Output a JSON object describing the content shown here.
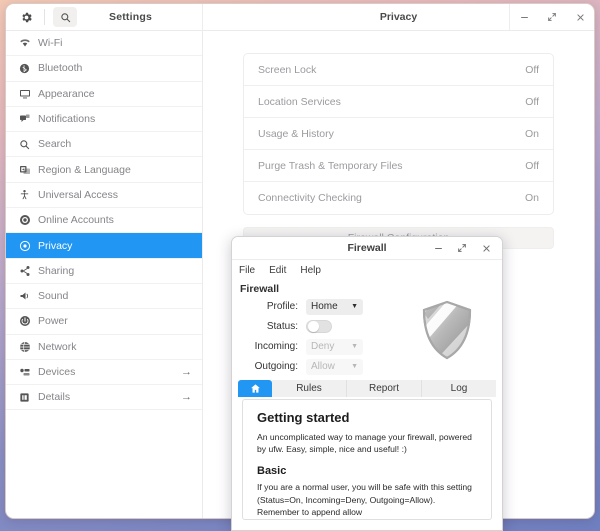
{
  "desktop": {
    "bg_top": "#f3c9b4",
    "bg_bottom": "#6f7fc0"
  },
  "settings_window": {
    "app_title": "Settings",
    "page_title": "Privacy",
    "accent": "#2196f3",
    "toolbar": {
      "gear_icon": "gear-icon",
      "search_icon": "search-icon"
    },
    "window_controls": [
      {
        "name": "minimize",
        "glyph": "–"
      },
      {
        "name": "restore",
        "glyph": "restore"
      },
      {
        "name": "close",
        "glyph": "×"
      }
    ],
    "sidebar": {
      "items": [
        {
          "label": "Wi-Fi",
          "icon": "wifi-icon",
          "active": false,
          "arrow": ""
        },
        {
          "label": "Bluetooth",
          "icon": "bluetooth-icon",
          "active": false,
          "arrow": ""
        },
        {
          "label": "Appearance",
          "icon": "monitor-icon",
          "active": false,
          "arrow": ""
        },
        {
          "label": "Notifications",
          "icon": "notification-icon",
          "active": false,
          "arrow": ""
        },
        {
          "label": "Search",
          "icon": "search-icon",
          "active": false,
          "arrow": ""
        },
        {
          "label": "Region & Language",
          "icon": "region-language-icon",
          "active": false,
          "arrow": ""
        },
        {
          "label": "Universal Access",
          "icon": "accessibility-icon",
          "active": false,
          "arrow": ""
        },
        {
          "label": "Online Accounts",
          "icon": "online-accounts-icon",
          "active": false,
          "arrow": ""
        },
        {
          "label": "Privacy",
          "icon": "privacy-icon",
          "active": true,
          "arrow": ""
        },
        {
          "label": "Sharing",
          "icon": "sharing-icon",
          "active": false,
          "arrow": ""
        },
        {
          "label": "Sound",
          "icon": "sound-icon",
          "active": false,
          "arrow": ""
        },
        {
          "label": "Power",
          "icon": "power-icon",
          "active": false,
          "arrow": ""
        },
        {
          "label": "Network",
          "icon": "network-icon",
          "active": false,
          "arrow": ""
        },
        {
          "label": "Devices",
          "icon": "devices-icon",
          "active": false,
          "arrow": "→"
        },
        {
          "label": "Details",
          "icon": "details-icon",
          "active": false,
          "arrow": "→"
        }
      ]
    },
    "privacy_panel": {
      "rows": [
        {
          "label": "Screen Lock",
          "value": "Off"
        },
        {
          "label": "Location Services",
          "value": "Off"
        },
        {
          "label": "Usage & History",
          "value": "On"
        },
        {
          "label": "Purge Trash & Temporary Files",
          "value": "Off"
        },
        {
          "label": "Connectivity Checking",
          "value": "On"
        }
      ],
      "firewall_button": "Firewall Configuration"
    }
  },
  "firewall_window": {
    "title": "Firewall",
    "window_controls": [
      {
        "name": "minimize",
        "glyph": "–"
      },
      {
        "name": "restore",
        "glyph": "restore"
      },
      {
        "name": "close",
        "glyph": "×"
      }
    ],
    "menu": [
      "File",
      "Edit",
      "Help"
    ],
    "section_title": "Firewall",
    "controls": {
      "profile_label": "Profile:",
      "profile_value": "Home",
      "status_label": "Status:",
      "status_on": false,
      "incoming_label": "Incoming:",
      "incoming_value": "Deny",
      "outgoing_label": "Outgoing:",
      "outgoing_value": "Allow",
      "shield_icon": "shield-icon-disabled"
    },
    "tabs": [
      {
        "label": "",
        "icon": "home-icon",
        "active": true
      },
      {
        "label": "Rules",
        "icon": "",
        "active": false
      },
      {
        "label": "Report",
        "icon": "",
        "active": false
      },
      {
        "label": "Log",
        "icon": "",
        "active": false
      }
    ],
    "content": {
      "heading": "Getting started",
      "paragraph": "An uncomplicated way to manage your firewall, powered by ufw. Easy, simple, nice and useful! :)",
      "subheading": "Basic",
      "paragraph2": "If you are a normal user, you will be safe with this setting (Status=On, Incoming=Deny, Outgoing=Allow). Remember to append allow"
    }
  }
}
